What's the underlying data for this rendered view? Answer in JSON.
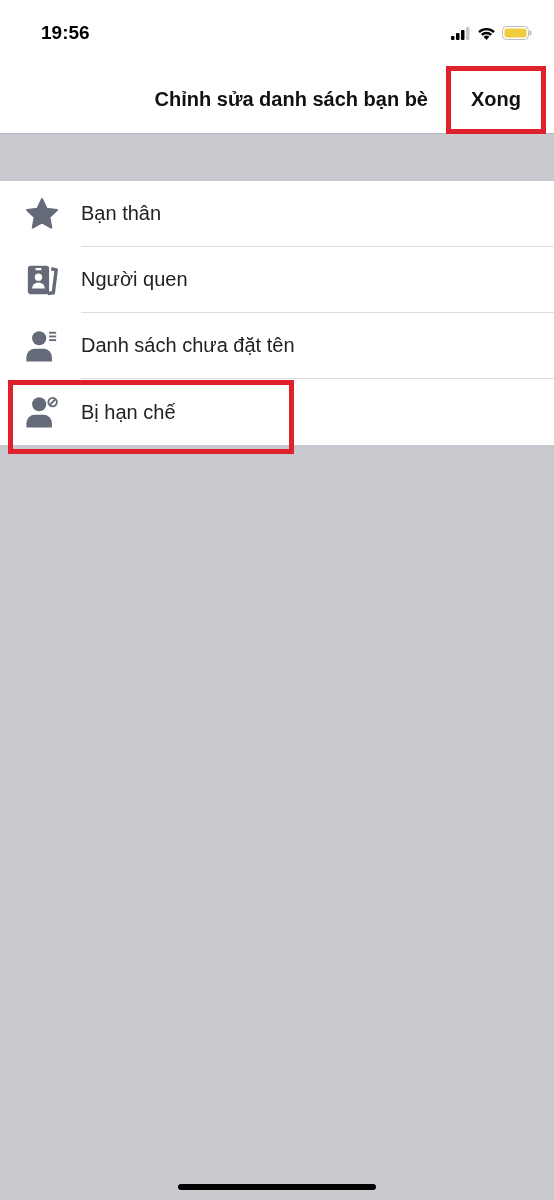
{
  "status_bar": {
    "time": "19:56"
  },
  "nav": {
    "title": "Chỉnh sửa danh sách bạn bè",
    "done": {
      "label": "Xong",
      "highlighted": true
    }
  },
  "lists": [
    {
      "label": "Bạn thân",
      "highlighted": false
    },
    {
      "label": "Người quen",
      "highlighted": false
    },
    {
      "label": "Danh sách chưa đặt tên",
      "highlighted": false
    },
    {
      "label": "Bị hạn chế",
      "highlighted": true
    }
  ]
}
